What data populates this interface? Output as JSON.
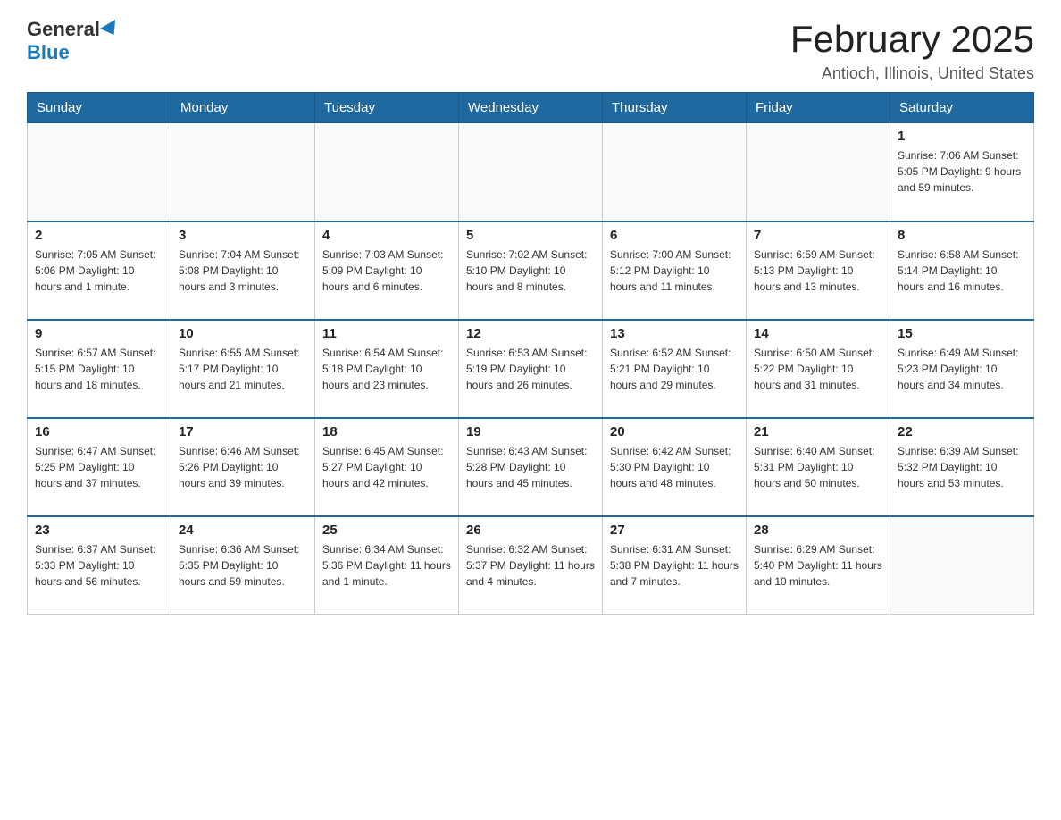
{
  "logo": {
    "general": "General",
    "blue": "Blue"
  },
  "title": "February 2025",
  "location": "Antioch, Illinois, United States",
  "weekdays": [
    "Sunday",
    "Monday",
    "Tuesday",
    "Wednesday",
    "Thursday",
    "Friday",
    "Saturday"
  ],
  "weeks": [
    [
      {
        "day": "",
        "info": ""
      },
      {
        "day": "",
        "info": ""
      },
      {
        "day": "",
        "info": ""
      },
      {
        "day": "",
        "info": ""
      },
      {
        "day": "",
        "info": ""
      },
      {
        "day": "",
        "info": ""
      },
      {
        "day": "1",
        "info": "Sunrise: 7:06 AM\nSunset: 5:05 PM\nDaylight: 9 hours\nand 59 minutes."
      }
    ],
    [
      {
        "day": "2",
        "info": "Sunrise: 7:05 AM\nSunset: 5:06 PM\nDaylight: 10 hours\nand 1 minute."
      },
      {
        "day": "3",
        "info": "Sunrise: 7:04 AM\nSunset: 5:08 PM\nDaylight: 10 hours\nand 3 minutes."
      },
      {
        "day": "4",
        "info": "Sunrise: 7:03 AM\nSunset: 5:09 PM\nDaylight: 10 hours\nand 6 minutes."
      },
      {
        "day": "5",
        "info": "Sunrise: 7:02 AM\nSunset: 5:10 PM\nDaylight: 10 hours\nand 8 minutes."
      },
      {
        "day": "6",
        "info": "Sunrise: 7:00 AM\nSunset: 5:12 PM\nDaylight: 10 hours\nand 11 minutes."
      },
      {
        "day": "7",
        "info": "Sunrise: 6:59 AM\nSunset: 5:13 PM\nDaylight: 10 hours\nand 13 minutes."
      },
      {
        "day": "8",
        "info": "Sunrise: 6:58 AM\nSunset: 5:14 PM\nDaylight: 10 hours\nand 16 minutes."
      }
    ],
    [
      {
        "day": "9",
        "info": "Sunrise: 6:57 AM\nSunset: 5:15 PM\nDaylight: 10 hours\nand 18 minutes."
      },
      {
        "day": "10",
        "info": "Sunrise: 6:55 AM\nSunset: 5:17 PM\nDaylight: 10 hours\nand 21 minutes."
      },
      {
        "day": "11",
        "info": "Sunrise: 6:54 AM\nSunset: 5:18 PM\nDaylight: 10 hours\nand 23 minutes."
      },
      {
        "day": "12",
        "info": "Sunrise: 6:53 AM\nSunset: 5:19 PM\nDaylight: 10 hours\nand 26 minutes."
      },
      {
        "day": "13",
        "info": "Sunrise: 6:52 AM\nSunset: 5:21 PM\nDaylight: 10 hours\nand 29 minutes."
      },
      {
        "day": "14",
        "info": "Sunrise: 6:50 AM\nSunset: 5:22 PM\nDaylight: 10 hours\nand 31 minutes."
      },
      {
        "day": "15",
        "info": "Sunrise: 6:49 AM\nSunset: 5:23 PM\nDaylight: 10 hours\nand 34 minutes."
      }
    ],
    [
      {
        "day": "16",
        "info": "Sunrise: 6:47 AM\nSunset: 5:25 PM\nDaylight: 10 hours\nand 37 minutes."
      },
      {
        "day": "17",
        "info": "Sunrise: 6:46 AM\nSunset: 5:26 PM\nDaylight: 10 hours\nand 39 minutes."
      },
      {
        "day": "18",
        "info": "Sunrise: 6:45 AM\nSunset: 5:27 PM\nDaylight: 10 hours\nand 42 minutes."
      },
      {
        "day": "19",
        "info": "Sunrise: 6:43 AM\nSunset: 5:28 PM\nDaylight: 10 hours\nand 45 minutes."
      },
      {
        "day": "20",
        "info": "Sunrise: 6:42 AM\nSunset: 5:30 PM\nDaylight: 10 hours\nand 48 minutes."
      },
      {
        "day": "21",
        "info": "Sunrise: 6:40 AM\nSunset: 5:31 PM\nDaylight: 10 hours\nand 50 minutes."
      },
      {
        "day": "22",
        "info": "Sunrise: 6:39 AM\nSunset: 5:32 PM\nDaylight: 10 hours\nand 53 minutes."
      }
    ],
    [
      {
        "day": "23",
        "info": "Sunrise: 6:37 AM\nSunset: 5:33 PM\nDaylight: 10 hours\nand 56 minutes."
      },
      {
        "day": "24",
        "info": "Sunrise: 6:36 AM\nSunset: 5:35 PM\nDaylight: 10 hours\nand 59 minutes."
      },
      {
        "day": "25",
        "info": "Sunrise: 6:34 AM\nSunset: 5:36 PM\nDaylight: 11 hours\nand 1 minute."
      },
      {
        "day": "26",
        "info": "Sunrise: 6:32 AM\nSunset: 5:37 PM\nDaylight: 11 hours\nand 4 minutes."
      },
      {
        "day": "27",
        "info": "Sunrise: 6:31 AM\nSunset: 5:38 PM\nDaylight: 11 hours\nand 7 minutes."
      },
      {
        "day": "28",
        "info": "Sunrise: 6:29 AM\nSunset: 5:40 PM\nDaylight: 11 hours\nand 10 minutes."
      },
      {
        "day": "",
        "info": ""
      }
    ]
  ]
}
